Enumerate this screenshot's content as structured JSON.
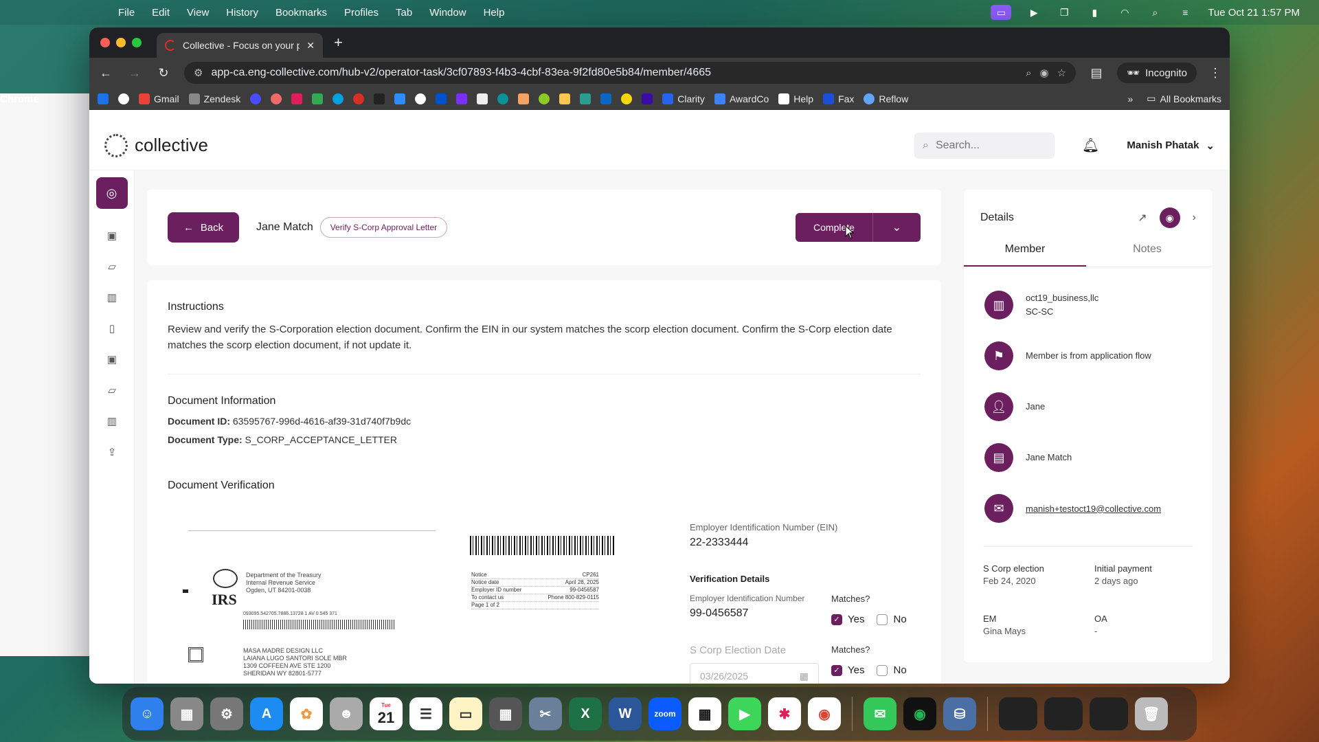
{
  "menubar": {
    "app": "Chrome",
    "items": [
      "File",
      "Edit",
      "View",
      "History",
      "Bookmarks",
      "Profiles",
      "Tab",
      "Window",
      "Help"
    ],
    "clock": "Tue Oct 21  1:57 PM"
  },
  "browser": {
    "tab_title": "Collective - Focus on your pa",
    "url": "app-ca.eng-collective.com/hub-v2/operator-task/3cf07893-f4b3-4cbf-83ea-9f2fd80e5b84/member/4665",
    "incognito_label": "Incognito",
    "bookmarks": [
      "Gmail",
      "Zendesk",
      "Clarity",
      "AwardCo",
      "Help",
      "Fax",
      "Reflow"
    ],
    "all_bookmarks": "All Bookmarks"
  },
  "app": {
    "logo": "collective",
    "search_placeholder": "Search...",
    "user_name": "Manish Phatak"
  },
  "task": {
    "back_label": "Back",
    "member_name": "Jane Match",
    "task_badge": "Verify S-Corp Approval Letter",
    "complete_label": "Complete"
  },
  "instructions": {
    "title": "Instructions",
    "text": "Review and verify the S-Corporation election document. Confirm the EIN in our system matches the scorp election document. Confirm the S-Corp election date matches the scorp election document, if not update it."
  },
  "document_info": {
    "title": "Document Information",
    "id_label": "Document ID:",
    "id_value": "63595767-996d-4616-af39-31d740f7b9dc",
    "type_label": "Document Type:",
    "type_value": "S_CORP_ACCEPTANCE_LETTER"
  },
  "verification": {
    "title": "Document Verification",
    "doc_image": {
      "dept": "Department of the Treasury",
      "irs_service": "Internal Revenue Service",
      "city": "Ogden, UT 84201-0038",
      "irs": "IRS",
      "number_line": "093095.542705.7886.13728 1 AV 0.545 371",
      "notice_rows": [
        {
          "k": "Notice",
          "v": "CP261"
        },
        {
          "k": "Notice date",
          "v": "April 28, 2025"
        },
        {
          "k": "Employer ID number",
          "v": "99-0456587"
        },
        {
          "k": "To contact us",
          "v": "Phone 800-829-0115"
        },
        {
          "k": "Page 1 of 2",
          "v": ""
        }
      ],
      "address": [
        "MASA MADRE DESIGN LLC",
        "LAIANA LUGO SANTORI SOLE MBR",
        "1309 COFFEEN AVE STE 1200",
        "SHERIDAN WY 82801-5777"
      ]
    },
    "ein_label": "Employer Identification Number (EIN)",
    "ein_value": "22-2333444",
    "details_title": "Verification Details",
    "ein_detail_label": "Employer Identification Number",
    "ein_detail_value": "99-0456587",
    "matches_label": "Matches?",
    "yes": "Yes",
    "no": "No",
    "election_date_label": "S Corp Election Date",
    "election_date_value": "03/26/2025"
  },
  "details": {
    "title": "Details",
    "tabs": [
      "Member",
      "Notes"
    ],
    "items": [
      {
        "line1": "oct19_business,llc",
        "line2": "SC-SC",
        "icon": "building-icon"
      },
      {
        "line1": "Member is from application flow",
        "line2": "",
        "icon": "flag-icon"
      },
      {
        "line1": "Jane",
        "line2": "",
        "icon": "person-icon"
      },
      {
        "line1": "Jane Match",
        "line2": "",
        "icon": "id-card-icon"
      },
      {
        "line1": "manish+testoct19@collective.com",
        "line2": "",
        "icon": "mail-icon"
      }
    ],
    "meta": [
      {
        "label": "S Corp election",
        "value": "Feb 24, 2020"
      },
      {
        "label": "Initial payment",
        "value": "2 days ago"
      },
      {
        "label": "EM",
        "value": "Gina Mays"
      },
      {
        "label": "OA",
        "value": "-"
      }
    ]
  },
  "dock": {
    "calendar_day": "21",
    "calendar_month": "Tue",
    "zoom": "zoom"
  }
}
